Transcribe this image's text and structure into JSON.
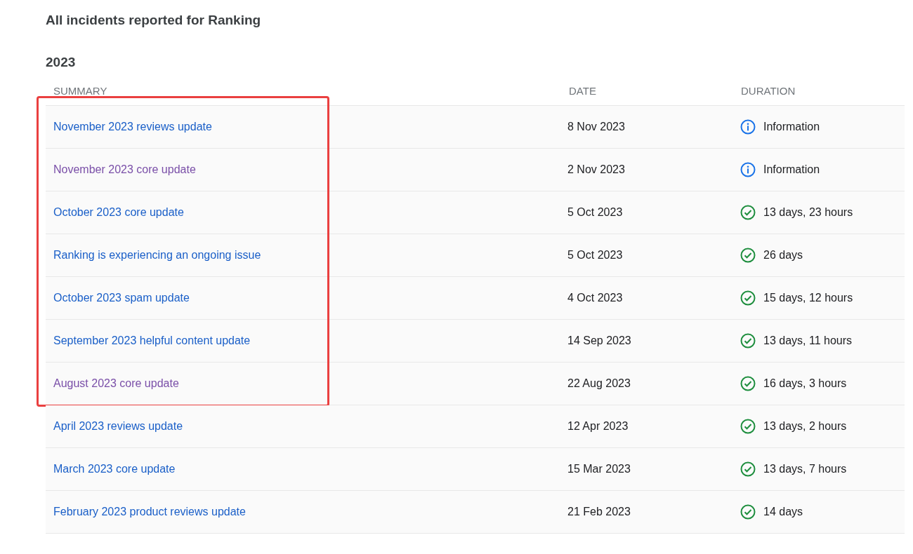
{
  "title": "All incidents reported for Ranking",
  "year": "2023",
  "columns": [
    "SUMMARY",
    "DATE",
    "DURATION"
  ],
  "groups": [
    {
      "highlighted": true,
      "rows": [
        {
          "summary": "November 2023 reviews update",
          "visited": false,
          "date": "8 Nov 2023",
          "kind": "info",
          "duration": "Information"
        },
        {
          "summary": "November 2023 core update",
          "visited": true,
          "date": "2 Nov 2023",
          "kind": "info",
          "duration": "Information"
        },
        {
          "summary": "October 2023 core update",
          "visited": false,
          "date": "5 Oct 2023",
          "kind": "resolved",
          "duration": "13 days, 23 hours"
        },
        {
          "summary": "Ranking is experiencing an ongoing issue",
          "visited": false,
          "date": "5 Oct 2023",
          "kind": "resolved",
          "duration": "26 days"
        },
        {
          "summary": "October 2023 spam update",
          "visited": false,
          "date": "4 Oct 2023",
          "kind": "resolved",
          "duration": "15 days, 12 hours"
        },
        {
          "summary": "September 2023 helpful content update",
          "visited": false,
          "date": "14 Sep 2023",
          "kind": "resolved",
          "duration": "13 days, 11 hours"
        },
        {
          "summary": "August 2023 core update",
          "visited": true,
          "date": "22 Aug 2023",
          "kind": "resolved",
          "duration": "16 days, 3 hours"
        }
      ]
    },
    {
      "highlighted": false,
      "rows": [
        {
          "summary": "April 2023 reviews update",
          "visited": false,
          "date": "12 Apr 2023",
          "kind": "resolved",
          "duration": "13 days, 2 hours"
        },
        {
          "summary": "March 2023 core update",
          "visited": false,
          "date": "15 Mar 2023",
          "kind": "resolved",
          "duration": "13 days, 7 hours"
        },
        {
          "summary": "February 2023 product reviews update",
          "visited": false,
          "date": "21 Feb 2023",
          "kind": "resolved",
          "duration": "14 days"
        }
      ]
    }
  ]
}
